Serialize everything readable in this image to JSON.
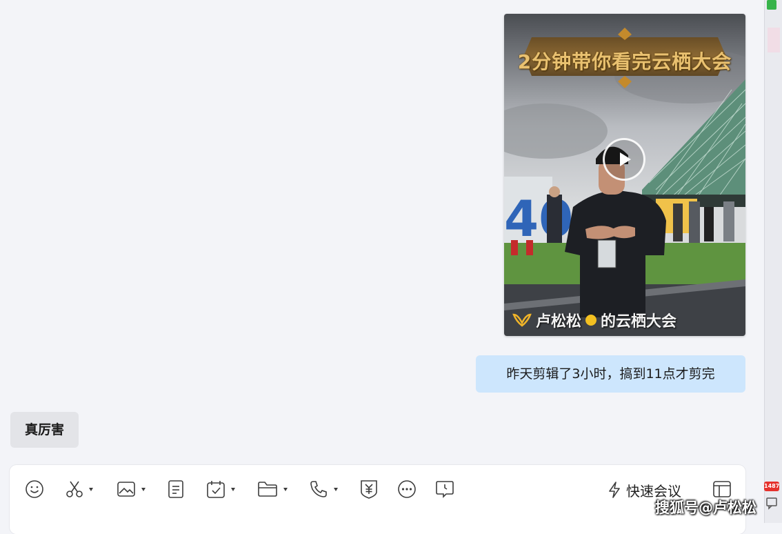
{
  "video_message": {
    "title_text": "2分钟带你看完云栖大会",
    "caption_name": "卢松松",
    "caption_rest": "的云栖大会",
    "play_icon": "play-icon"
  },
  "messages": {
    "self_text": "昨天剪辑了3小时，搞到11点才剪完",
    "other_text": "真厉害"
  },
  "toolbar": {
    "items": [
      {
        "name": "emoji-button",
        "icon": "smiley-icon"
      },
      {
        "name": "screenshot-button",
        "icon": "scissors-icon",
        "dropdown": true
      },
      {
        "name": "image-button",
        "icon": "image-icon",
        "dropdown": true
      },
      {
        "name": "document-button",
        "icon": "document-icon"
      },
      {
        "name": "schedule-button",
        "icon": "calendar-check-icon",
        "dropdown": true
      },
      {
        "name": "file-button",
        "icon": "folder-icon",
        "dropdown": true
      },
      {
        "name": "call-button",
        "icon": "phone-icon",
        "dropdown": true
      },
      {
        "name": "red-packet-button",
        "icon": "yuan-shield-icon"
      },
      {
        "name": "more-button",
        "icon": "more-icon"
      },
      {
        "name": "chat-history-button",
        "icon": "clock-bubble-icon"
      }
    ],
    "quick_meeting_label": "快速会议",
    "side_panel_icon": "panel-icon"
  },
  "sidebar_edge": {
    "badge_text": "1487"
  },
  "watermark": "搜狐号@卢松松",
  "colors": {
    "background": "#f3f4f8",
    "self_bubble": "#cde6fd",
    "other_bubble": "#e3e4e8",
    "title_gold": "#e9c170"
  }
}
